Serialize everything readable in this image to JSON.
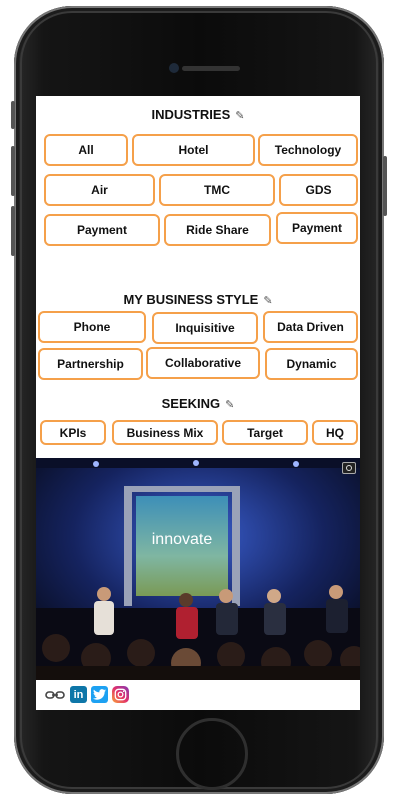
{
  "industries": {
    "title": "INDUSTRIES",
    "chips": [
      "All",
      "Hotel",
      "Technology",
      "Air",
      "TMC",
      "GDS",
      "Payment",
      "Ride Share",
      "Payment"
    ]
  },
  "business_style": {
    "title": "MY BUSINESS STYLE",
    "chips": [
      "Phone",
      "Inquisitive",
      "Data Driven",
      "Partnership",
      "Collaborative",
      "Dynamic"
    ]
  },
  "seeking": {
    "title": "SEEKING",
    "chips": [
      "KPIs",
      "Business Mix",
      "Target",
      "HQ"
    ]
  },
  "photo": {
    "screen_text": "innovate"
  },
  "social": {
    "icons": [
      "link-icon",
      "linkedin-icon",
      "twitter-icon",
      "instagram-icon"
    ],
    "linkedin_text": "in"
  },
  "colors": {
    "chip_border": "#f5a04a",
    "linkedin": "#0e76a8",
    "twitter": "#1da1f2"
  }
}
